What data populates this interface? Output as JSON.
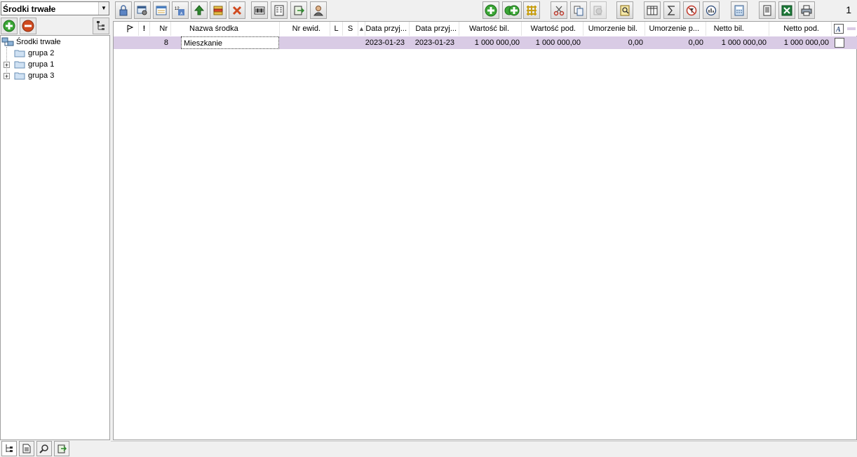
{
  "left_panel": {
    "combo_value": "Środki trwałe",
    "tree": [
      {
        "label": "Środki trwałe",
        "expandable": false
      },
      {
        "label": "grupa 2",
        "expandable": false
      },
      {
        "label": "grupa 1",
        "expandable": true
      },
      {
        "label": "grupa 3",
        "expandable": true
      }
    ],
    "expander_symbol": "+"
  },
  "toolbar": {
    "page_number": "1"
  },
  "grid": {
    "columns": [
      "",
      "!",
      "Nr",
      "Nazwa środka",
      "Nr ewid.",
      "L",
      "S",
      "Data przyj...",
      "Data przyj...",
      "Wartość bil.",
      "Wartość pod.",
      "Umorzenie bil.",
      "Umorzenie p...",
      "Netto bil.",
      "Netto pod."
    ],
    "rows": [
      {
        "nr": "8",
        "nazwa": "Mieszkanie",
        "nr_ewid": "",
        "l": "",
        "s": "",
        "data1": "2023-01-23",
        "data2": "2023-01-23",
        "wartosc_bil": "1 000 000,00",
        "wartosc_pod": "1 000 000,00",
        "umorzenie_bil": "0,00",
        "umorzenie_pod": "0,00",
        "netto_bil": "1 000 000,00",
        "netto_pod": "1 000 000,00"
      }
    ]
  },
  "colors": {
    "selected_row": "#d9cbe5",
    "green": "#3aa635",
    "red": "#d04a1f"
  }
}
